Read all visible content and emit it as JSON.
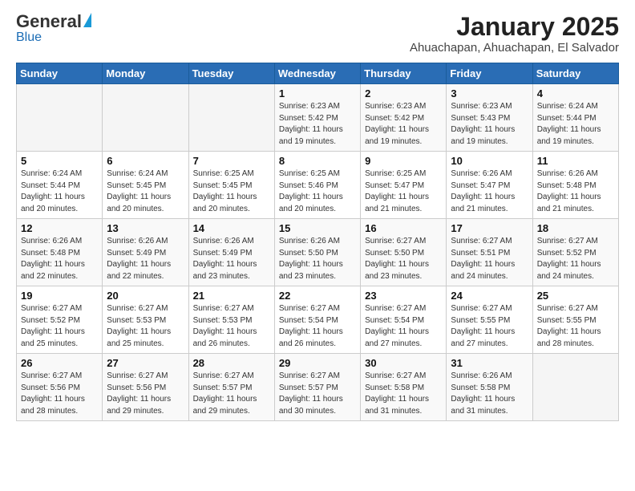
{
  "header": {
    "logo_general": "General",
    "logo_blue": "Blue",
    "month_title": "January 2025",
    "location": "Ahuachapan, Ahuachapan, El Salvador"
  },
  "weekdays": [
    "Sunday",
    "Monday",
    "Tuesday",
    "Wednesday",
    "Thursday",
    "Friday",
    "Saturday"
  ],
  "weeks": [
    [
      {
        "day": "",
        "info": ""
      },
      {
        "day": "",
        "info": ""
      },
      {
        "day": "",
        "info": ""
      },
      {
        "day": "1",
        "info": "Sunrise: 6:23 AM\nSunset: 5:42 PM\nDaylight: 11 hours and 19 minutes."
      },
      {
        "day": "2",
        "info": "Sunrise: 6:23 AM\nSunset: 5:42 PM\nDaylight: 11 hours and 19 minutes."
      },
      {
        "day": "3",
        "info": "Sunrise: 6:23 AM\nSunset: 5:43 PM\nDaylight: 11 hours and 19 minutes."
      },
      {
        "day": "4",
        "info": "Sunrise: 6:24 AM\nSunset: 5:44 PM\nDaylight: 11 hours and 19 minutes."
      }
    ],
    [
      {
        "day": "5",
        "info": "Sunrise: 6:24 AM\nSunset: 5:44 PM\nDaylight: 11 hours and 20 minutes."
      },
      {
        "day": "6",
        "info": "Sunrise: 6:24 AM\nSunset: 5:45 PM\nDaylight: 11 hours and 20 minutes."
      },
      {
        "day": "7",
        "info": "Sunrise: 6:25 AM\nSunset: 5:45 PM\nDaylight: 11 hours and 20 minutes."
      },
      {
        "day": "8",
        "info": "Sunrise: 6:25 AM\nSunset: 5:46 PM\nDaylight: 11 hours and 20 minutes."
      },
      {
        "day": "9",
        "info": "Sunrise: 6:25 AM\nSunset: 5:47 PM\nDaylight: 11 hours and 21 minutes."
      },
      {
        "day": "10",
        "info": "Sunrise: 6:26 AM\nSunset: 5:47 PM\nDaylight: 11 hours and 21 minutes."
      },
      {
        "day": "11",
        "info": "Sunrise: 6:26 AM\nSunset: 5:48 PM\nDaylight: 11 hours and 21 minutes."
      }
    ],
    [
      {
        "day": "12",
        "info": "Sunrise: 6:26 AM\nSunset: 5:48 PM\nDaylight: 11 hours and 22 minutes."
      },
      {
        "day": "13",
        "info": "Sunrise: 6:26 AM\nSunset: 5:49 PM\nDaylight: 11 hours and 22 minutes."
      },
      {
        "day": "14",
        "info": "Sunrise: 6:26 AM\nSunset: 5:49 PM\nDaylight: 11 hours and 23 minutes."
      },
      {
        "day": "15",
        "info": "Sunrise: 6:26 AM\nSunset: 5:50 PM\nDaylight: 11 hours and 23 minutes."
      },
      {
        "day": "16",
        "info": "Sunrise: 6:27 AM\nSunset: 5:50 PM\nDaylight: 11 hours and 23 minutes."
      },
      {
        "day": "17",
        "info": "Sunrise: 6:27 AM\nSunset: 5:51 PM\nDaylight: 11 hours and 24 minutes."
      },
      {
        "day": "18",
        "info": "Sunrise: 6:27 AM\nSunset: 5:52 PM\nDaylight: 11 hours and 24 minutes."
      }
    ],
    [
      {
        "day": "19",
        "info": "Sunrise: 6:27 AM\nSunset: 5:52 PM\nDaylight: 11 hours and 25 minutes."
      },
      {
        "day": "20",
        "info": "Sunrise: 6:27 AM\nSunset: 5:53 PM\nDaylight: 11 hours and 25 minutes."
      },
      {
        "day": "21",
        "info": "Sunrise: 6:27 AM\nSunset: 5:53 PM\nDaylight: 11 hours and 26 minutes."
      },
      {
        "day": "22",
        "info": "Sunrise: 6:27 AM\nSunset: 5:54 PM\nDaylight: 11 hours and 26 minutes."
      },
      {
        "day": "23",
        "info": "Sunrise: 6:27 AM\nSunset: 5:54 PM\nDaylight: 11 hours and 27 minutes."
      },
      {
        "day": "24",
        "info": "Sunrise: 6:27 AM\nSunset: 5:55 PM\nDaylight: 11 hours and 27 minutes."
      },
      {
        "day": "25",
        "info": "Sunrise: 6:27 AM\nSunset: 5:55 PM\nDaylight: 11 hours and 28 minutes."
      }
    ],
    [
      {
        "day": "26",
        "info": "Sunrise: 6:27 AM\nSunset: 5:56 PM\nDaylight: 11 hours and 28 minutes."
      },
      {
        "day": "27",
        "info": "Sunrise: 6:27 AM\nSunset: 5:56 PM\nDaylight: 11 hours and 29 minutes."
      },
      {
        "day": "28",
        "info": "Sunrise: 6:27 AM\nSunset: 5:57 PM\nDaylight: 11 hours and 29 minutes."
      },
      {
        "day": "29",
        "info": "Sunrise: 6:27 AM\nSunset: 5:57 PM\nDaylight: 11 hours and 30 minutes."
      },
      {
        "day": "30",
        "info": "Sunrise: 6:27 AM\nSunset: 5:58 PM\nDaylight: 11 hours and 31 minutes."
      },
      {
        "day": "31",
        "info": "Sunrise: 6:26 AM\nSunset: 5:58 PM\nDaylight: 11 hours and 31 minutes."
      },
      {
        "day": "",
        "info": ""
      }
    ]
  ]
}
